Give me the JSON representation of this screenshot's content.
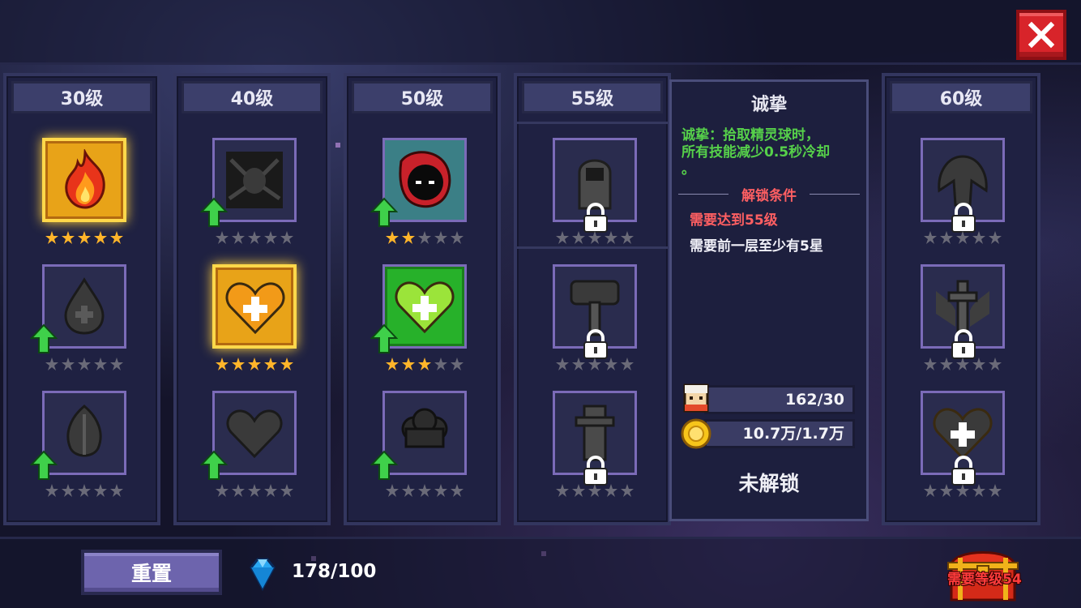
{
  "header": {
    "close_icon": "close-x-icon"
  },
  "columns": [
    {
      "level": "30级",
      "slots": [
        {
          "icon": "fire-icon",
          "state": "gold",
          "stars_filled": 5,
          "upgrade": false
        },
        {
          "icon": "water-drop-icon",
          "state": "dark",
          "stars_filled": 0,
          "upgrade": true
        },
        {
          "icon": "leaf-icon",
          "state": "dark",
          "stars_filled": 0,
          "upgrade": true
        }
      ]
    },
    {
      "level": "40级",
      "slots": [
        {
          "icon": "spider-icon",
          "state": "dark",
          "stars_filled": 0,
          "upgrade": true
        },
        {
          "icon": "heart-plus-icon",
          "state": "gold",
          "stars_filled": 5,
          "upgrade": false
        },
        {
          "icon": "heart-icon",
          "state": "dark",
          "stars_filled": 0,
          "upgrade": true
        }
      ]
    },
    {
      "level": "50级",
      "slots": [
        {
          "icon": "hooded-shadow-icon",
          "state": "teal",
          "stars_filled": 2,
          "upgrade": true
        },
        {
          "icon": "heart-plus-icon",
          "state": "green",
          "stars_filled": 3,
          "upgrade": true
        },
        {
          "icon": "cloud-icon",
          "state": "dark",
          "stars_filled": 0,
          "upgrade": true
        }
      ]
    },
    {
      "level": "55级",
      "slots": [
        {
          "icon": "hooded-figure-icon",
          "state": "locked",
          "stars_filled": 0
        },
        {
          "icon": "hammer-icon",
          "state": "locked",
          "stars_filled": 0
        },
        {
          "icon": "tombstone-icon",
          "state": "locked",
          "stars_filled": 0
        }
      ]
    },
    {
      "level": "60级",
      "slots": [
        {
          "icon": "wings-icon",
          "state": "locked",
          "stars_filled": 0
        },
        {
          "icon": "cross-wings-icon",
          "state": "locked",
          "stars_filled": 0
        },
        {
          "icon": "heart-plus-icon",
          "state": "locked",
          "stars_filled": 0
        }
      ]
    }
  ],
  "info_panel": {
    "title": "诚挚",
    "desc_line1": "诚挚：拾取精灵球时，",
    "desc_line2": "所有技能减少0.5秒冷却",
    "desc_line3": "。",
    "unlock_title": "解锁条件",
    "cond_level": "需要达到55级",
    "cond_stars": "需要前一层至少有5星",
    "resource_1": {
      "icon": "character-face-icon",
      "value": "162/30"
    },
    "resource_2": {
      "icon": "gold-coin-icon",
      "value": "10.7万/1.7万"
    },
    "status": "未解锁"
  },
  "footer": {
    "reset_label": "重置",
    "gem_icon": "blue-gem-icon",
    "gem_count": "178/100",
    "chest_icon": "treasure-chest-icon",
    "chest_label": "需要等级54"
  },
  "colors": {
    "gold": "#ffd84a",
    "green": "#27b12a",
    "slot_border": "#7b6bb8",
    "alert_red": "#ff5f62",
    "desc_green": "#56d04a"
  }
}
